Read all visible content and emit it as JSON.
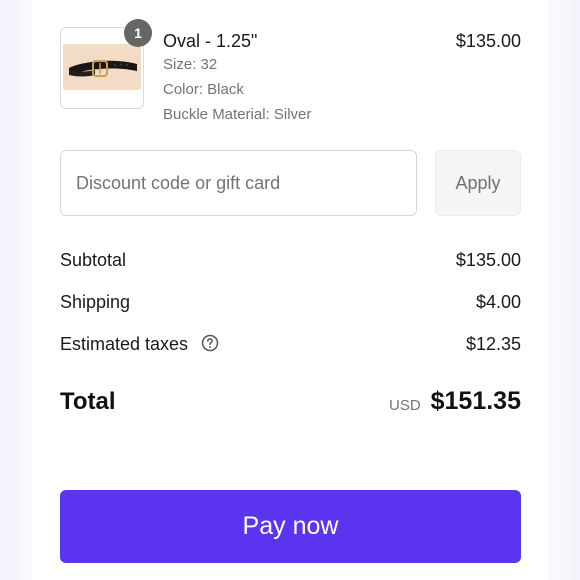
{
  "line_item": {
    "quantity": "1",
    "title": "Oval - 1.25\"",
    "size": "Size: 32",
    "color": "Color: Black",
    "buckle": "Buckle Material: Silver",
    "price": "$135.00"
  },
  "discount": {
    "placeholder": "Discount code or gift card",
    "apply_label": "Apply"
  },
  "summary": {
    "subtotal_label": "Subtotal",
    "subtotal_value": "$135.00",
    "shipping_label": "Shipping",
    "shipping_value": "$4.00",
    "taxes_label": "Estimated taxes",
    "taxes_value": "$12.35",
    "total_label": "Total",
    "currency": "USD",
    "total_value": "$151.35"
  },
  "pay_button_label": "Pay now",
  "colors": {
    "accent": "#5b34f0",
    "badge": "#666666"
  }
}
